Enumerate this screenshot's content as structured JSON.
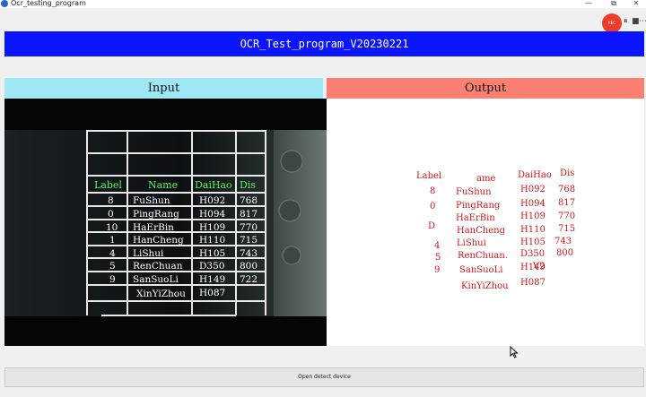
{
  "window": {
    "title": "Ocr_testing_program",
    "controls": [
      "—",
      "⧉",
      "✕"
    ]
  },
  "recorder": {
    "badge": "REC",
    "pause": "⏸",
    "stop": "■",
    "more": "⋯"
  },
  "banner": {
    "text": "OCR_Test_program_V20230221"
  },
  "input": {
    "header": "Input"
  },
  "output": {
    "header": "Output"
  },
  "camera_table": {
    "headers": [
      "Label",
      "Name",
      "DaiHao",
      "Dis"
    ],
    "rows": [
      [
        "8",
        "FuShun",
        "H092",
        "768"
      ],
      [
        "0",
        "PingRang",
        "H094",
        "817"
      ],
      [
        "10",
        "HaErBin",
        "H109",
        "770"
      ],
      [
        "1",
        "HanCheng",
        "H110",
        "715"
      ],
      [
        "4",
        "LiShui",
        "H105",
        "743"
      ],
      [
        "5",
        "RenChuan",
        "D350",
        "800"
      ],
      [
        "9",
        "SanSuoLi",
        "H149",
        "722"
      ],
      [
        "",
        "XinYiZhou",
        "H087",
        ""
      ]
    ]
  },
  "ocr_output": [
    "Label",
    "ame",
    "DaiHao",
    "Dis",
    "8",
    "FuShun",
    "H092",
    "768",
    "0",
    "PingRang",
    "H094",
    "817",
    "HaErBin",
    "H109",
    "770",
    "D",
    "HanCheng",
    "H110",
    "715",
    "LiShui",
    "H105",
    "743",
    "4",
    "RenChuan.",
    "D350",
    "800",
    "5",
    "SanSuoLi",
    "H149",
    "V2",
    "9",
    "KinYiZhou",
    "H087"
  ],
  "footer": {
    "detect_button": "Open detect device"
  },
  "colors": {
    "banner": "#0a14ff",
    "input_header": "#9ee8f6",
    "output_header": "#fb8072",
    "ocr_text": "#d2151c",
    "screen_green": "#5bf05b"
  }
}
